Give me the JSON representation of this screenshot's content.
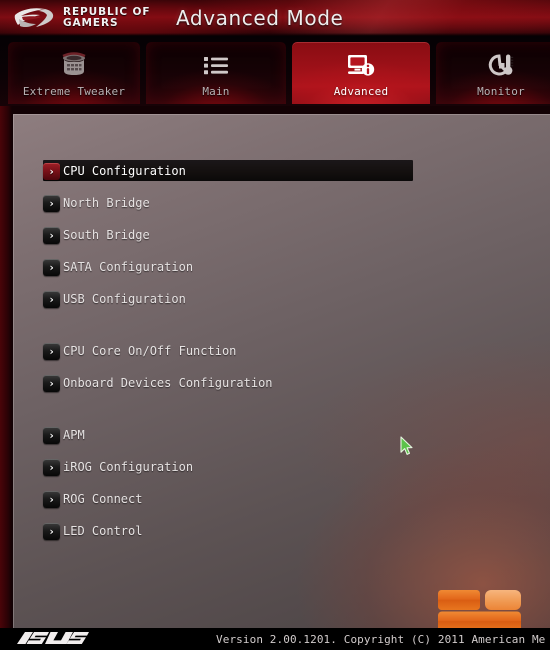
{
  "header": {
    "brand_line1": "REPUBLIC OF",
    "brand_line2": "GAMERS",
    "logo_icon": "rog-eye-logo",
    "title": "Advanced Mode"
  },
  "tabs": [
    {
      "label": "Extreme Tweaker",
      "icon": "turbine-icon",
      "active": false
    },
    {
      "label": "Main",
      "icon": "list-icon",
      "active": false
    },
    {
      "label": "Advanced",
      "icon": "monitor-info-icon",
      "active": true
    },
    {
      "label": "Monitor",
      "icon": "gauge-thermometer-icon",
      "active": false
    }
  ],
  "menu": {
    "items": [
      {
        "label": "CPU Configuration",
        "selected": true,
        "gap_after": false
      },
      {
        "label": "North Bridge",
        "selected": false,
        "gap_after": false
      },
      {
        "label": "South Bridge",
        "selected": false,
        "gap_after": false
      },
      {
        "label": "SATA Configuration",
        "selected": false,
        "gap_after": false
      },
      {
        "label": "USB Configuration",
        "selected": false,
        "gap_after": true
      },
      {
        "label": "CPU Core On/Off Function",
        "selected": false,
        "gap_after": false
      },
      {
        "label": "Onboard Devices Configuration",
        "selected": false,
        "gap_after": true
      },
      {
        "label": "APM",
        "selected": false,
        "gap_after": false
      },
      {
        "label": "iROG Configuration",
        "selected": false,
        "gap_after": false
      },
      {
        "label": "ROG Connect",
        "selected": false,
        "gap_after": false
      },
      {
        "label": "LED Control",
        "selected": false,
        "gap_after": false
      }
    ],
    "arrow_glyph": "›"
  },
  "content": {
    "ami_logo_icon": "ami-logo",
    "cursor_icon": "mouse-pointer-icon"
  },
  "footer": {
    "vendor_logo": "asus-logo",
    "vendor_name": "ASUS",
    "version_text": "Version 2.00.1201. Copyright (C) 2011 American Me"
  },
  "colors": {
    "accent_red": "#bc1620",
    "header_red": "#7e0c13",
    "panel_gray": "#6e6264",
    "ami_orange": "#e8751a",
    "cursor_green": "#5cc24a"
  }
}
